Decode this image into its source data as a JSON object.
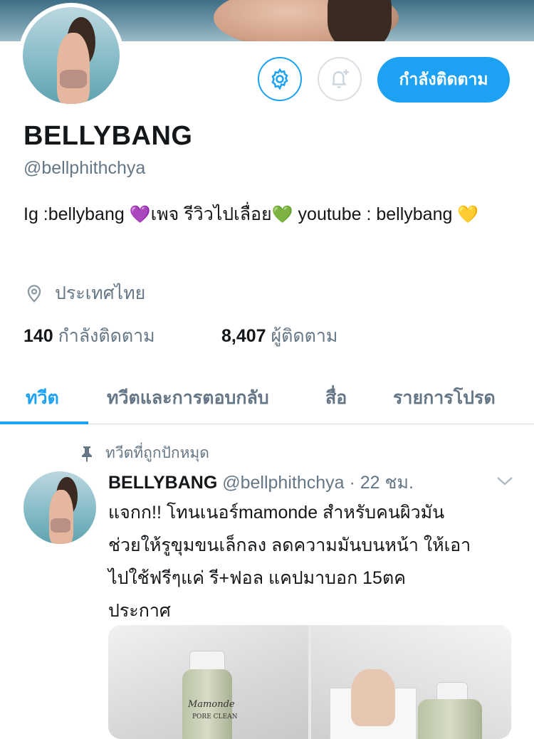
{
  "profile": {
    "display_name": "BELLYBANG",
    "handle": "@bellphithchya",
    "bio_part1": "Ig :bellybang ",
    "bio_heart1": "💜",
    "bio_part2": "เพจ รีวิวไปเลื่อย",
    "bio_heart2": "💚",
    "bio_part3": " youtube : bellybang ",
    "bio_heart3": "💛",
    "location": "ประเทศไทย",
    "following_count": "140",
    "following_label": "กำลังติดตาม",
    "followers_count": "8,407",
    "followers_label": "ผู้ติดตาม"
  },
  "actions": {
    "settings_icon": "gear-icon",
    "notify_icon": "bell-plus-icon",
    "follow_label": "กำลังติดตาม"
  },
  "tabs": [
    {
      "label": "ทวีต",
      "active": true
    },
    {
      "label": "ทวีตและการตอบกลับ",
      "active": false
    },
    {
      "label": "สื่อ",
      "active": false
    },
    {
      "label": "รายการโปรด",
      "active": false
    }
  ],
  "tweet": {
    "pinned_label": "ทวีตที่ถูกปักหมุด",
    "author_name": "BELLYBANG",
    "author_handle": "@bellphithchya",
    "separator": " · ",
    "time": "22 ชม.",
    "line1": "แจกก!! โทนเนอร์mamonde สำหรับคนผิวมัน",
    "line2": "ช่วยให้รูขุมขนเล็กลง ลดความมันบนหน้า ให้เอา",
    "line3": "ไปใช้ฟรีๆแค่ รี+ฟอล แคปมาบอก 15ตค",
    "line4": "ประกาศ",
    "media_brand_text": "Mamonde",
    "media_product_text": "PORE CLEAN"
  },
  "colors": {
    "accent": "#1da1f2",
    "secondary_text": "#657786",
    "primary_text": "#14171a",
    "divider": "#d9dfe4"
  }
}
